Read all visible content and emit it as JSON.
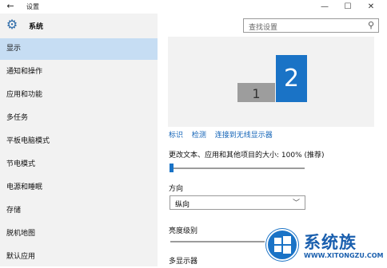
{
  "window": {
    "title": "设置",
    "back_glyph": "←",
    "min_glyph": "—",
    "max_glyph": "☐",
    "close_glyph": "✕"
  },
  "sidebar": {
    "header": "系统",
    "items": [
      {
        "label": "显示",
        "active": true
      },
      {
        "label": "通知和操作"
      },
      {
        "label": "应用和功能"
      },
      {
        "label": "多任务"
      },
      {
        "label": "平板电脑模式"
      },
      {
        "label": "节电模式"
      },
      {
        "label": "电源和睡眠"
      },
      {
        "label": "存储"
      },
      {
        "label": "脱机地图"
      },
      {
        "label": "默认应用"
      }
    ]
  },
  "search": {
    "placeholder": "查找设置"
  },
  "display": {
    "monitor1": "1",
    "monitor2": "2",
    "links": [
      "标识",
      "检测",
      "连接到无线显示器"
    ],
    "scale_label": "更改文本、应用和其他项目的大小: 100% (推荐)",
    "scale_value_fraction": 0.0,
    "orientation_label": "方向",
    "orientation_value": "纵向",
    "brightness_label": "亮度级别",
    "multi_display_label": "多显示器"
  },
  "watermark": {
    "text": "系统族",
    "url": "WWW.XITONGZU.COM"
  },
  "colors": {
    "accent": "#1a73c6",
    "sidebar_bg": "#f2f2f2",
    "active_item_bg": "#c6ddf3",
    "link": "#1565b8"
  }
}
